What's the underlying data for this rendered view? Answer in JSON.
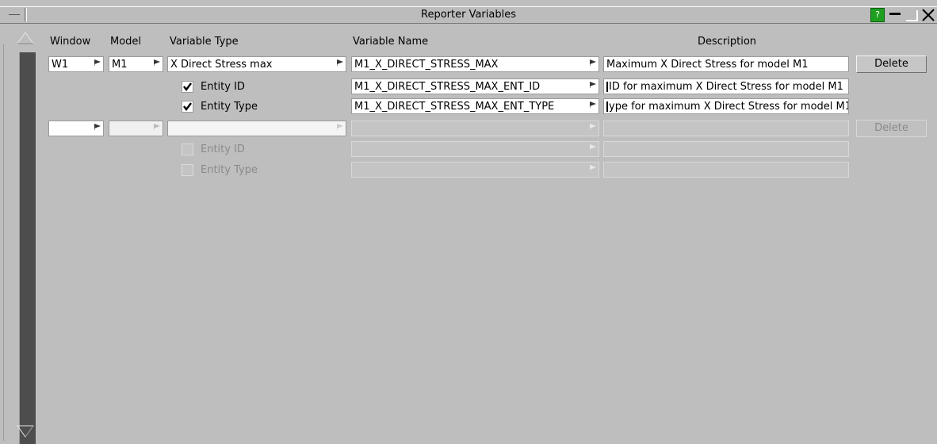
{
  "window": {
    "title": "Reporter Variables"
  },
  "title_buttons": {
    "help_label": "?"
  },
  "columns": {
    "window": "Window",
    "model": "Model",
    "variable_type": "Variable Type",
    "variable_name": "Variable Name",
    "description": "Description"
  },
  "rows": [
    {
      "window": "W1",
      "model": "M1",
      "variable_type": "X Direct Stress max",
      "variable_name": "M1_X_DIRECT_STRESS_MAX",
      "description": "Maximum X Direct Stress for model M1",
      "delete_label": "Delete",
      "sub": [
        {
          "checked": true,
          "label": "Entity ID",
          "variable_name": "M1_X_DIRECT_STRESS_MAX_ENT_ID",
          "description": "ID for maximum X Direct Stress for model M1"
        },
        {
          "checked": true,
          "label": "Entity Type",
          "variable_name": "M1_X_DIRECT_STRESS_MAX_ENT_TYPE",
          "description": "ype for maximum X Direct Stress for model M1"
        }
      ]
    },
    {
      "window": "",
      "model": "",
      "variable_type": "",
      "variable_name": "",
      "description": "",
      "delete_label": "Delete",
      "sub": [
        {
          "checked": false,
          "label": "Entity ID",
          "variable_name": "",
          "description": ""
        },
        {
          "checked": false,
          "label": "Entity Type",
          "variable_name": "",
          "description": ""
        }
      ]
    }
  ],
  "colors": {
    "background": "#bebebe",
    "help_button": "#1f9f1f",
    "scroll_track": "#4d4d4d"
  }
}
